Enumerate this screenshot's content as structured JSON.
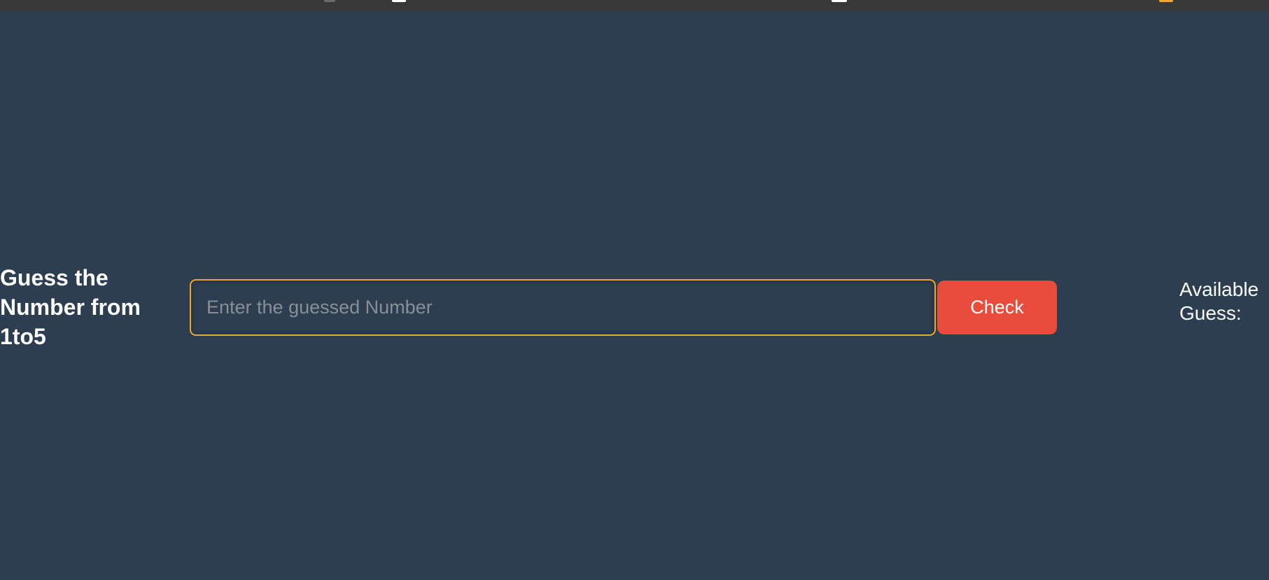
{
  "game": {
    "title_line1": "Guess the",
    "title_line2": "Number from",
    "title_line3": "1to5",
    "input_placeholder": "Enter the guessed Number",
    "input_value": "",
    "check_label": "Check",
    "available_line1": "Available",
    "available_line2": "Guess:"
  },
  "colors": {
    "background": "#2c3e50",
    "input_border": "#f1a828",
    "button": "#e74c3c"
  }
}
